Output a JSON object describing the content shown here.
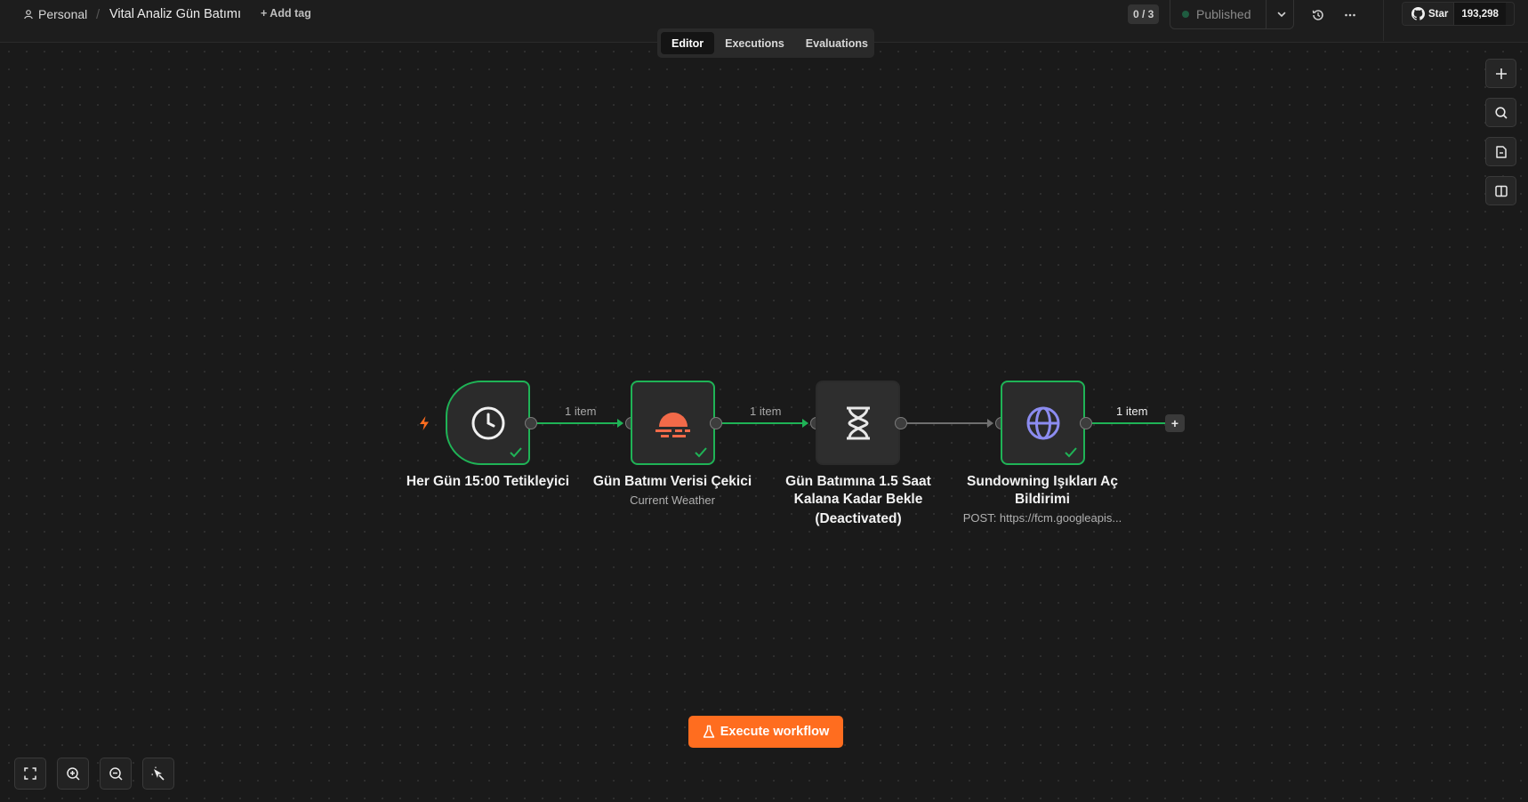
{
  "header": {
    "project": "Personal",
    "separator": "/",
    "workflow_title": "Vital Analiz Gün Batımı",
    "add_tag": "+ Add tag",
    "pager": "0 / 3",
    "status": "Published",
    "github": {
      "star_label": "Star",
      "star_count": "193,298"
    }
  },
  "tabs": [
    {
      "label": "Editor",
      "active": true
    },
    {
      "label": "Executions",
      "active": false
    },
    {
      "label": "Evaluations",
      "active": false
    }
  ],
  "nodes": [
    {
      "name": "Her Gün 15:00 Tetikleyici",
      "subtitle": "",
      "icon": "clock-icon",
      "status": "success"
    },
    {
      "name": "Gün Batımı Verisi Çekici",
      "subtitle": "Current Weather",
      "icon": "sunset-icon",
      "status": "success"
    },
    {
      "name_line1": "Gün Batımına 1.5 Saat",
      "name_line2": "Kalana Kadar Bekle",
      "name_line3": "(Deactivated)",
      "icon": "hourglass-icon",
      "status": "deactivated"
    },
    {
      "name_line1": "Sundowning Işıkları Aç",
      "name_line2": "Bildirimi",
      "subtitle": "POST: https://fcm.googleapis...",
      "icon": "globe-icon",
      "status": "success"
    }
  ],
  "connections": [
    {
      "label": "1 item"
    },
    {
      "label": "1 item"
    },
    {
      "label": ""
    },
    {
      "label": "1 item"
    }
  ],
  "execute_button": "Execute workflow",
  "colors": {
    "accent": "#ff6d1f",
    "success": "#1fb356",
    "canvas": "#1a1a1a",
    "globe": "#8c8cf0"
  }
}
